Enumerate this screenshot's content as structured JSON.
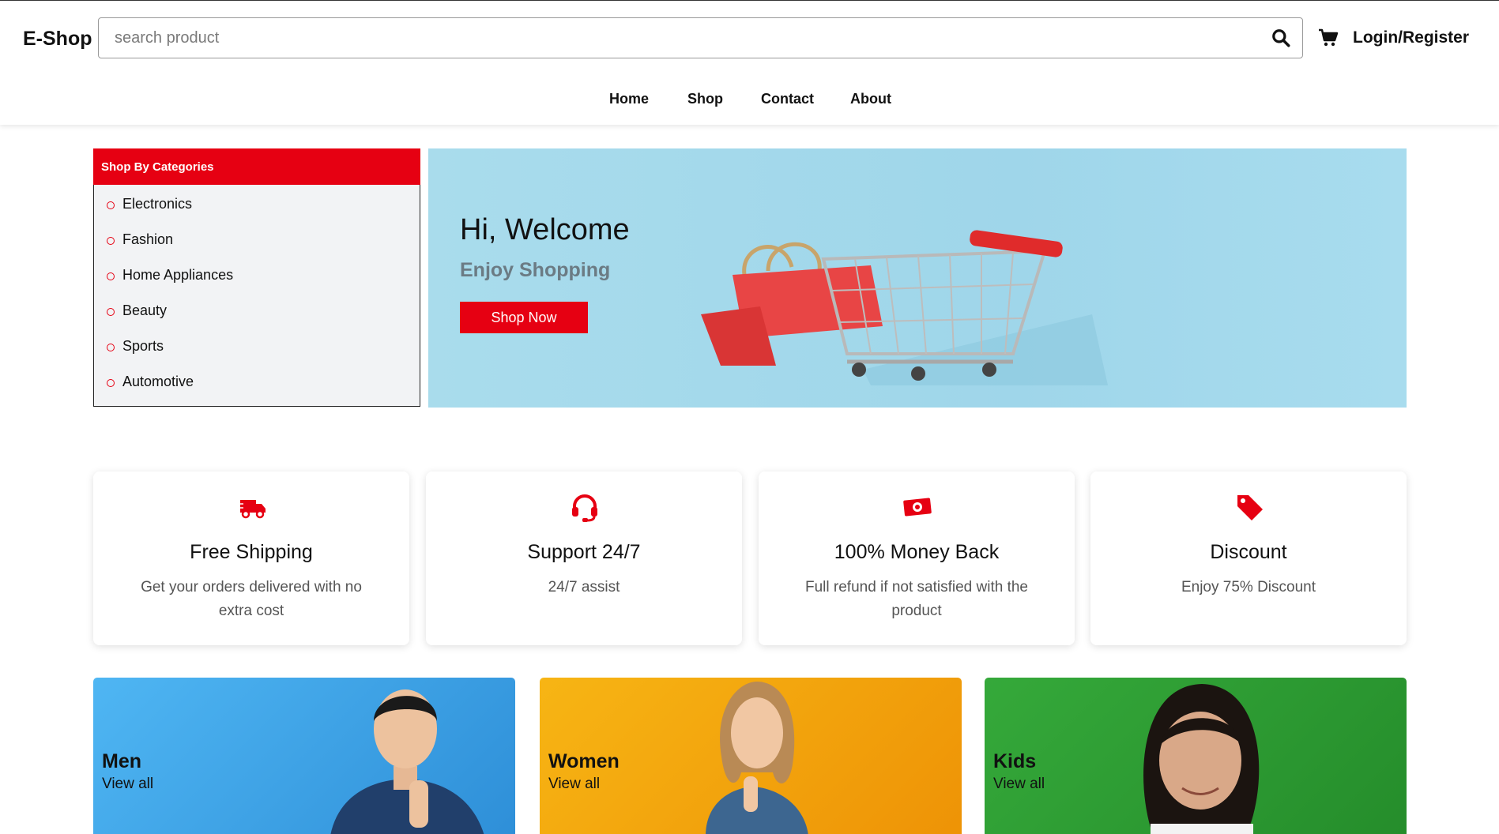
{
  "header": {
    "logo": "E-Shop",
    "search_placeholder": "search product",
    "search_icon": "search-icon",
    "cart_icon": "cart-icon",
    "login_label": "Login/Register"
  },
  "nav": {
    "items": [
      "Home",
      "Shop",
      "Contact",
      "About"
    ]
  },
  "categories": {
    "title": "Shop By Categories",
    "items": [
      "Electronics",
      "Fashion",
      "Home Appliances",
      "Beauty",
      "Sports",
      "Automotive"
    ]
  },
  "hero": {
    "title": "Hi, Welcome",
    "subtitle": "Enjoy Shopping",
    "button": "Shop Now"
  },
  "features": [
    {
      "icon": "truck-icon",
      "title": "Free Shipping",
      "desc": "Get your orders delivered with no extra cost"
    },
    {
      "icon": "headset-icon",
      "title": "Support 24/7",
      "desc": "24/7 assist"
    },
    {
      "icon": "money-icon",
      "title": "100% Money Back",
      "desc": "Full refund if not satisfied with the product"
    },
    {
      "icon": "tag-icon",
      "title": "Discount",
      "desc": "Enjoy 75% Discount"
    }
  ],
  "collections": [
    {
      "title": "Men",
      "link": "View all"
    },
    {
      "title": "Women",
      "link": "View all"
    },
    {
      "title": "Kids",
      "link": "View all"
    }
  ],
  "colors": {
    "accent": "#e60012",
    "hero_bg": "#a3d8eb",
    "men_bg": "#3fa7e8",
    "women_bg": "#f2a20c",
    "kids_bg": "#2f9e35"
  }
}
